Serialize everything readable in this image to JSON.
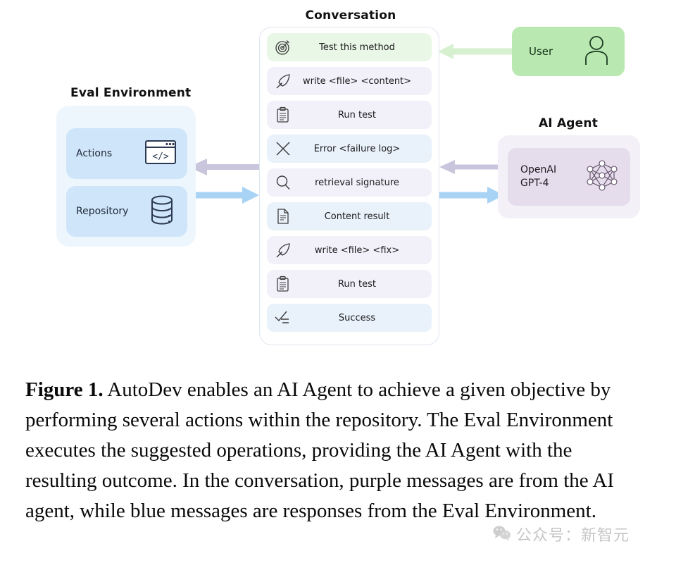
{
  "diagram": {
    "eval_environment": {
      "title": "Eval Environment",
      "cards": [
        {
          "label": "Actions",
          "icon": "code-window-icon"
        },
        {
          "label": "Repository",
          "icon": "database-icon"
        }
      ],
      "panel_color": "#eef6fd",
      "card_color": "#cfe5fa"
    },
    "conversation": {
      "title": "Conversation",
      "messages": [
        {
          "icon": "target-icon",
          "text": "Test this method",
          "source": "user",
          "color": "#e9f7e6"
        },
        {
          "icon": "quill-icon",
          "text": "write <file> <content>",
          "source": "agent",
          "color": "#f2f1fa"
        },
        {
          "icon": "clipboard-icon",
          "text": "Run test",
          "source": "agent",
          "color": "#f2f1fa"
        },
        {
          "icon": "x-icon",
          "text": "Error <failure log>",
          "source": "env",
          "color": "#e9f1fb"
        },
        {
          "icon": "magnifier-icon",
          "text": "retrieval signature",
          "source": "agent",
          "color": "#f2f1fa"
        },
        {
          "icon": "document-icon",
          "text": "Content result",
          "source": "env",
          "color": "#e9f1fb"
        },
        {
          "icon": "quill-icon",
          "text": "write <file> <fix>",
          "source": "agent",
          "color": "#f2f1fa"
        },
        {
          "icon": "clipboard-icon",
          "text": "Run test",
          "source": "agent",
          "color": "#f2f1fa"
        },
        {
          "icon": "checklist-icon",
          "text": "Success",
          "source": "env",
          "color": "#e9f1fb"
        }
      ]
    },
    "user": {
      "label": "User",
      "icon": "person-icon",
      "color": "#b9e8b0"
    },
    "ai_agent": {
      "title": "AI Agent",
      "model": "OpenAI\nGPT-4",
      "icon": "neural-network-icon",
      "panel_color": "#f3f0f8",
      "card_color": "#e5dcec"
    },
    "arrows": [
      {
        "name": "user-to-conversation",
        "direction": "left",
        "color": "#d6f0d0"
      },
      {
        "name": "agent-to-conversation",
        "direction": "left",
        "color": "#c9c5dd"
      },
      {
        "name": "conversation-to-agent",
        "direction": "right",
        "color": "#a8d3f5"
      },
      {
        "name": "conversation-to-eval",
        "direction": "left",
        "color": "#c9c5dd"
      },
      {
        "name": "eval-to-conversation",
        "direction": "right",
        "color": "#a8d3f5"
      }
    ]
  },
  "caption": {
    "label": "Figure 1.",
    "body": " AutoDev enables an AI Agent to achieve a given objective by performing several actions within the repository. The Eval Environment executes the suggested operations, providing the AI Agent with the resulting outcome. In the conversation, purple messages are from the AI agent, while blue messages are responses from the Eval Environment."
  },
  "watermark": {
    "text": "公众号：新智元",
    "icon": "wechat-icon"
  }
}
